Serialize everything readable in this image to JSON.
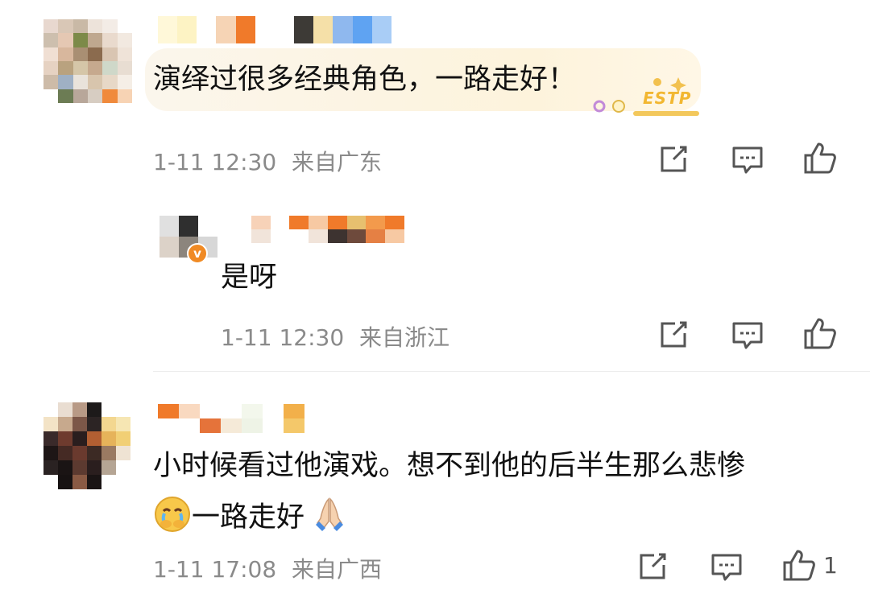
{
  "comments": [
    {
      "text": "演绎过很多经典角色，一路走好！",
      "time": "1-11 12:30",
      "location": "来自广东",
      "badge": "ESTP"
    },
    {
      "text": "是呀",
      "time": "1-11 12:30",
      "location": "来自浙江"
    },
    {
      "text_line1": "小时候看过他演戏。想不到他的后半生那么悲惨",
      "text_line2": "一路走好",
      "time": "1-11 17:08",
      "location": "来自广西",
      "like_count": "1",
      "emoji_1": "crying-face-icon",
      "emoji_2": "folded-hands-icon"
    }
  ],
  "colors": {
    "text": "#111111",
    "meta": "#8a8a8a",
    "icon": "#555555",
    "bubble": "#fdf3dc",
    "verified_badge": "#f08a24"
  }
}
